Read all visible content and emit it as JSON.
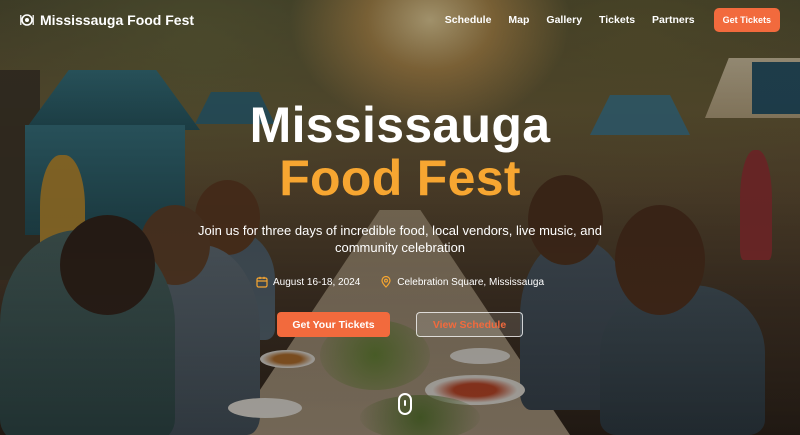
{
  "nav": {
    "brand": "Mississauga Food Fest",
    "brand_icon": "utensils-icon",
    "links": [
      "Schedule",
      "Map",
      "Gallery",
      "Tickets",
      "Partners"
    ],
    "cta": "Get Tickets"
  },
  "hero": {
    "title_line1": "Mississauga",
    "title_line2": "Food Fest",
    "subtitle": "Join us for three days of incredible food, local vendors, live music, and community celebration",
    "date": "August 16-18, 2024",
    "date_icon": "calendar-icon",
    "location": "Celebration Square, Mississauga",
    "location_icon": "map-pin-icon",
    "primary_button": "Get Your Tickets",
    "secondary_button": "View Schedule",
    "scroll_icon": "mouse-scroll-icon"
  },
  "colors": {
    "accent": "#f26a3d",
    "title_highlight": "#f7a631",
    "text": "#ffffff"
  }
}
